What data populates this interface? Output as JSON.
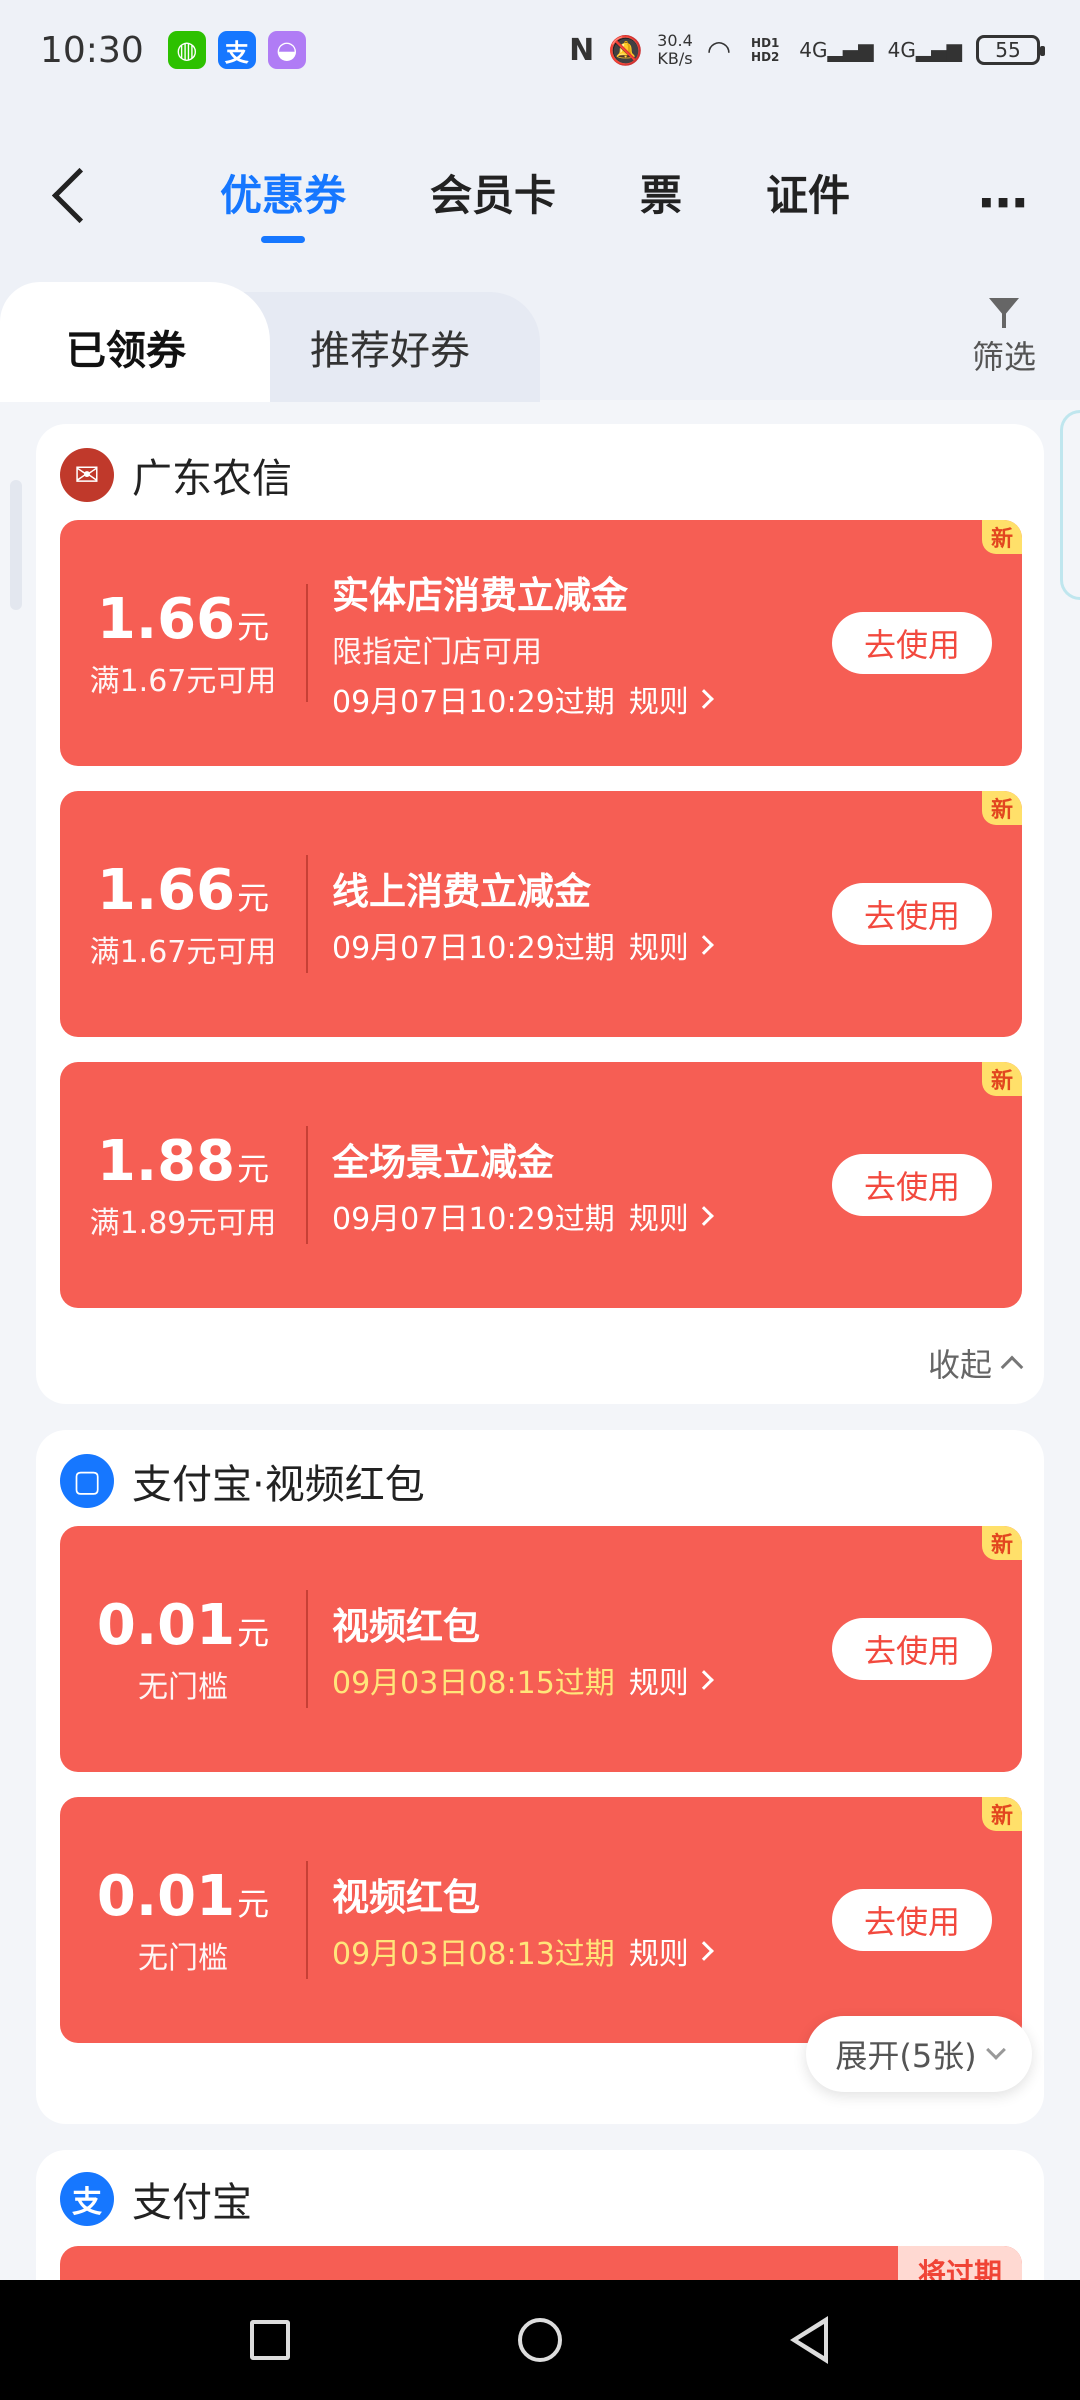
{
  "status_bar": {
    "time": "10:30",
    "net_speed_value": "30.4",
    "net_speed_unit": "KB/s",
    "signal_1": "4G",
    "signal_2": "4G",
    "hd_label": "HD1 HD2",
    "battery": "55",
    "apps": [
      {
        "icon": "wechat-icon",
        "color": "#2dc100",
        "glyph": "◍"
      },
      {
        "icon": "alipay-icon",
        "color": "#1677ff",
        "glyph": "支"
      },
      {
        "icon": "app-icon",
        "color": "#b07cf5",
        "glyph": "◒"
      }
    ]
  },
  "header": {
    "tabs": [
      {
        "label": "优惠券",
        "active": true
      },
      {
        "label": "会员卡",
        "active": false
      },
      {
        "label": "票",
        "active": false
      },
      {
        "label": "证件",
        "active": false
      }
    ],
    "more": "⋯"
  },
  "subtabs": {
    "received": "已领券",
    "recommended": "推荐好券",
    "filter": "筛选"
  },
  "sections": [
    {
      "title": "广东农信",
      "logo_color": "#c0392b",
      "coupons": [
        {
          "amount": "1.66",
          "unit": "元",
          "condition": "满1.67元可用",
          "name": "实体店消费立减金",
          "desc": "限指定门店可用",
          "expiry": "09月07日10:29过期",
          "rule": "规则",
          "button": "去使用",
          "badge": "新"
        },
        {
          "amount": "1.66",
          "unit": "元",
          "condition": "满1.67元可用",
          "name": "线上消费立减金",
          "expiry": "09月07日10:29过期",
          "rule": "规则",
          "button": "去使用",
          "badge": "新"
        },
        {
          "amount": "1.88",
          "unit": "元",
          "condition": "满1.89元可用",
          "name": "全场景立减金",
          "expiry": "09月07日10:29过期",
          "rule": "规则",
          "button": "去使用",
          "badge": "新"
        }
      ],
      "collapse": "收起"
    },
    {
      "title": "支付宝·视频红包",
      "logo_color": "#1677ff",
      "coupons": [
        {
          "amount": "0.01",
          "unit": "元",
          "condition": "无门槛",
          "name": "视频红包",
          "expiry": "09月03日08:15过期",
          "rule": "规则",
          "button": "去使用",
          "badge": "新"
        },
        {
          "amount": "0.01",
          "unit": "元",
          "condition": "无门槛",
          "name": "视频红包",
          "expiry": "09月03日08:13过期",
          "rule": "规则",
          "button": "去使用",
          "badge": "新"
        }
      ],
      "expand": "展开(5张)"
    },
    {
      "title": "支付宝",
      "logo_color": "#1677ff",
      "badge": "将过期"
    }
  ],
  "colors": {
    "accent": "#1677ff",
    "coupon_red": "#f65e54",
    "expiry_yellow": "#ffe57a",
    "badge_yellow": "#ffe06a"
  }
}
